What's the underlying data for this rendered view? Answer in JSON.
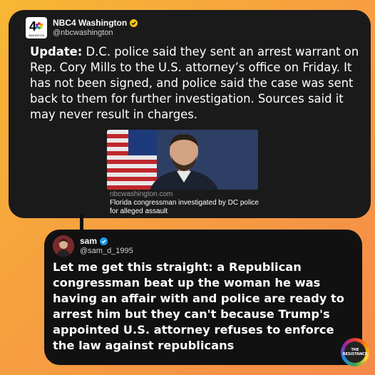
{
  "post1": {
    "display_name": "NBC4 Washington",
    "handle": "@nbcwashington",
    "avatar_icon": "nbc4-logo",
    "avatar_text": "4",
    "avatar_subtext": "WASHINGTON",
    "update_label": "Update:",
    "text": " D.C. police said they sent an arrest warrant on Rep. Cory Mills to the U.S. attorney’s office on Friday. It has not been signed, and police said the case was sent back to them for further investigation. Sources said it may never result in charges.",
    "media": {
      "source": "nbcwashington.com",
      "title": "Florida congressman investigated by DC police for alleged assault"
    }
  },
  "post2": {
    "display_name": "sam",
    "handle": "@sam_d_1995",
    "text": "Let me get this straight: a Republican congressman beat up the woman he was having an affair with and police are ready to arrest him but they can't because Trump's appointed U.S. attorney refuses to enforce the law against republicans"
  },
  "watermark": {
    "line1": "THE",
    "line2": "RESISTANCE"
  },
  "colors": {
    "verified": "#f5c518",
    "card_bg": "#1a1a1a",
    "background_gradient": [
      "#f7b733",
      "#f48a4a"
    ]
  }
}
